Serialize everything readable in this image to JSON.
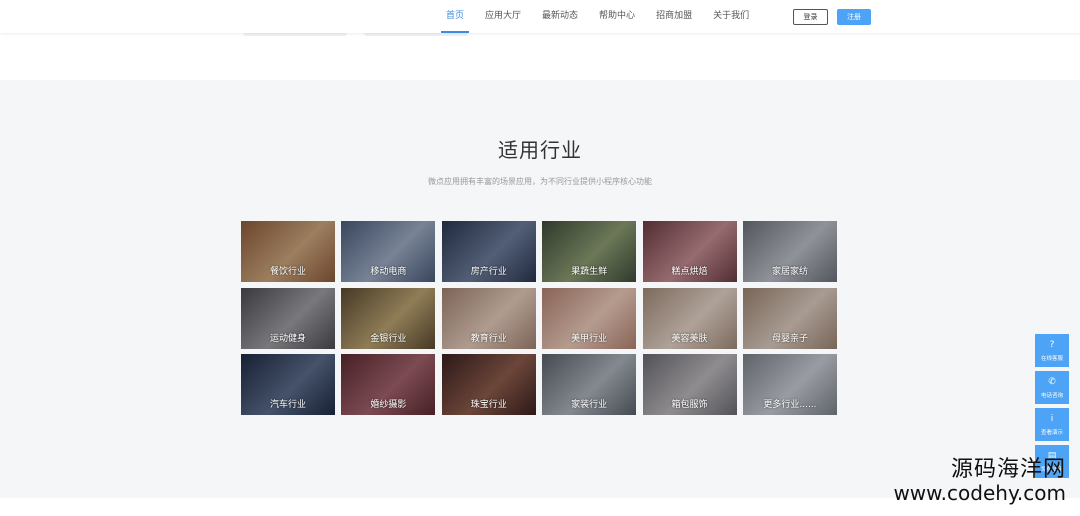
{
  "nav": {
    "items": [
      {
        "label": "首页",
        "active": true
      },
      {
        "label": "应用大厅",
        "active": false
      },
      {
        "label": "最新动态",
        "active": false
      },
      {
        "label": "帮助中心",
        "active": false
      },
      {
        "label": "招商加盟",
        "active": false
      },
      {
        "label": "关于我们",
        "active": false
      }
    ],
    "login": "登录",
    "register": "注册"
  },
  "section": {
    "title": "适用行业",
    "subtitle": "微点应用拥有丰富的场景应用，为不同行业提供小程序核心功能"
  },
  "industries": [
    {
      "label": "餐饮行业",
      "c1": "#8a5a3a",
      "c2": "#c9a27a"
    },
    {
      "label": "移动电商",
      "c1": "#4a5a78",
      "c2": "#9aa8c0"
    },
    {
      "label": "房产行业",
      "c1": "#2a3550",
      "c2": "#6a7a98"
    },
    {
      "label": "果蔬生鲜",
      "c1": "#3e4a3a",
      "c2": "#8a9a70"
    },
    {
      "label": "糕点烘焙",
      "c1": "#6a3a40",
      "c2": "#c08a90"
    },
    {
      "label": "家居家纺",
      "c1": "#6a6e78",
      "c2": "#b8bcc4"
    },
    {
      "label": "运动健身",
      "c1": "#4a4a50",
      "c2": "#9a9aa0"
    },
    {
      "label": "金银行业",
      "c1": "#5a4a30",
      "c2": "#b8a070"
    },
    {
      "label": "教育行业",
      "c1": "#a08070",
      "c2": "#e0c8b8"
    },
    {
      "label": "美甲行业",
      "c1": "#b08070",
      "c2": "#e8c8b8"
    },
    {
      "label": "美容美肤",
      "c1": "#a08878",
      "c2": "#e0d0c4"
    },
    {
      "label": "母婴亲子",
      "c1": "#9a8270",
      "c2": "#d8c8bc"
    },
    {
      "label": "汽车行业",
      "c1": "#1e2a44",
      "c2": "#5a6a88"
    },
    {
      "label": "婚纱摄影",
      "c1": "#5a2a30",
      "c2": "#a0606a"
    },
    {
      "label": "珠宝行业",
      "c1": "#3a2020",
      "c2": "#8a5a4a"
    },
    {
      "label": "家装行业",
      "c1": "#5a6068",
      "c2": "#a8b0b8"
    },
    {
      "label": "箱包服饰",
      "c1": "#6a6a70",
      "c2": "#b8b4b8"
    },
    {
      "label": "更多行业......",
      "c1": "#7a8088",
      "c2": "#c4c8d0"
    }
  ],
  "tools": [
    {
      "icon": "question-icon",
      "glyph": "?",
      "label": "在线客服"
    },
    {
      "icon": "phone-icon",
      "glyph": "✆",
      "label": "电话咨询"
    },
    {
      "icon": "info-icon",
      "glyph": "i",
      "label": "查看演示"
    },
    {
      "icon": "document-icon",
      "glyph": "▤",
      "label": "免费试用"
    }
  ],
  "watermark": {
    "name": "源码海洋网",
    "url": "www.codehy.com"
  }
}
